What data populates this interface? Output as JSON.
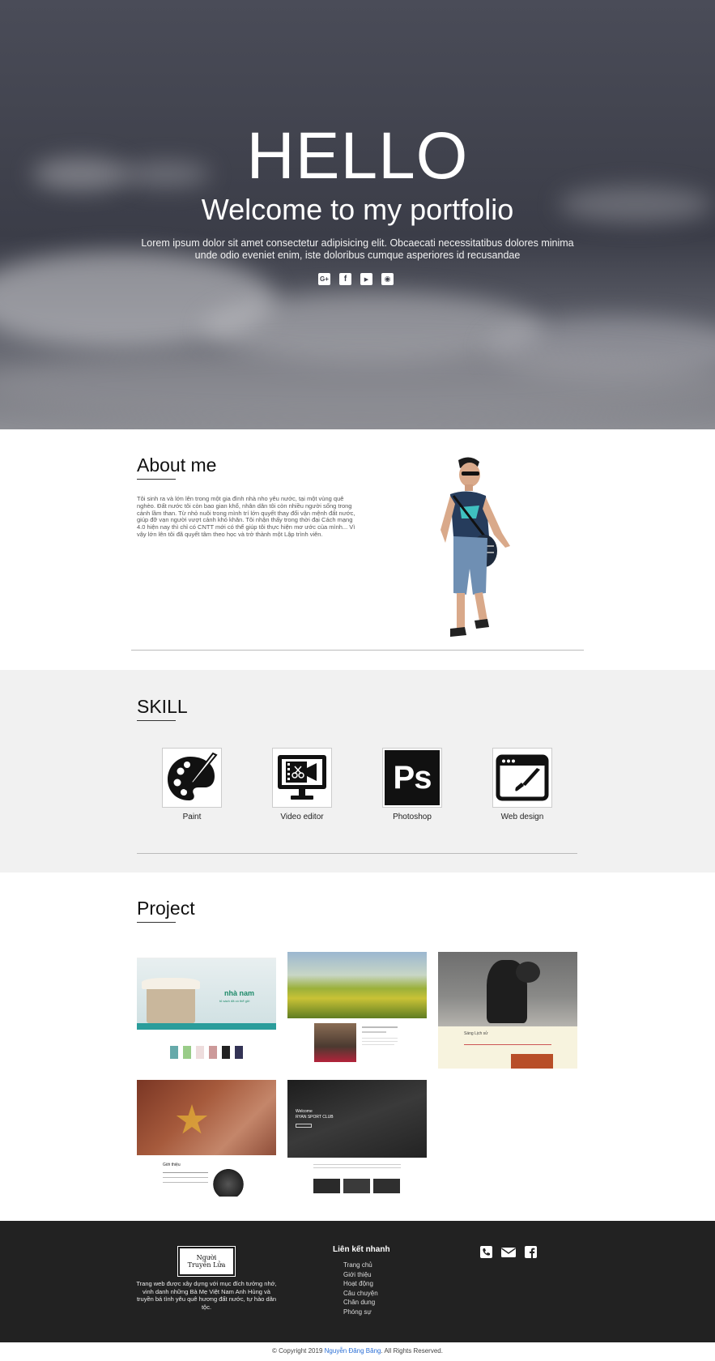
{
  "hero": {
    "title": "HELLO",
    "subtitle": "Welcome to my portfolio",
    "description": "Lorem ipsum dolor sit amet consectetur adipisicing elit. Obcaecati necessitatibus dolores minima unde odio eveniet enim, iste doloribus cumque asperiores id recusandae",
    "social": [
      {
        "icon": "google-plus-icon",
        "glyph": "G+"
      },
      {
        "icon": "facebook-icon",
        "glyph": "f"
      },
      {
        "icon": "youtube-icon",
        "glyph": "▶"
      },
      {
        "icon": "github-icon",
        "glyph": "◉"
      }
    ]
  },
  "about": {
    "title": "About me",
    "text": "Tôi sinh ra và lớn lên trong một gia đình nhà nho yêu nước, tại một vùng quê nghèo. Đất nước tôi còn bao gian khổ, nhân dân tôi còn nhiều người sống trong cảnh lầm than. Từ nhỏ nuôi trong mình trí lớn quyết thay đổi vận mệnh đất nước, giúp đỡ vạn người vượt cảnh khó khăn. Tôi nhận thấy trong thời đại Cách mạng 4.0 hiện nay thì chỉ có CNTT mới có thể giúp tôi thực hiện mơ ước của mình... Vì vậy lớn lên tôi đã quyết tâm theo học và trở thành một Lập trình viên."
  },
  "skill": {
    "title": "SKILL",
    "items": [
      {
        "label": "Paint",
        "icon": "paint-palette-icon"
      },
      {
        "label": "Video editor",
        "icon": "video-editor-icon"
      },
      {
        "label": "Photoshop",
        "icon": "photoshop-icon",
        "glyph": "Ps"
      },
      {
        "label": "Web design",
        "icon": "web-design-icon"
      }
    ]
  },
  "project": {
    "title": "Project",
    "thumbs": [
      {
        "name": "nha-nam",
        "caption": "nhà nam",
        "tagline": "tủ sách đã có thể gửi"
      },
      {
        "name": "rice-terraces"
      },
      {
        "name": "dark-warrior",
        "caption": "Sáng Lịch sử"
      },
      {
        "name": "vietnam-flag",
        "caption": "Giới thiệu"
      },
      {
        "name": "ryan-sport",
        "caption": "Welcome",
        "caption2": "RYAN SPORT CLUB"
      }
    ]
  },
  "footer": {
    "logo_text": "Người Truyền Lửa",
    "description": "Trang web được xây dựng với mục đích tưởng nhớ, vinh danh những Bà Mẹ Việt Nam Anh Hùng và truyền bá tình yêu quê hương đất nước, tự hào dân tộc.",
    "links_title": "Liên kết nhanh",
    "links": [
      "Trang chủ",
      "Giới thiệu",
      "Hoạt động",
      "Câu chuyện",
      "Chân dung",
      "Phóng sự"
    ],
    "contact_icons": [
      "phone-icon",
      "email-icon",
      "facebook-icon"
    ]
  },
  "copyright": {
    "prefix": "© Copyright 2019 ",
    "name": "Nguyễn Đăng Băng",
    "suffix": ". All Rights Reserved."
  },
  "colors": {
    "footer_bg": "#222222",
    "skill_bg": "#f1f1f1",
    "link_accent": "#2b6fd6"
  }
}
